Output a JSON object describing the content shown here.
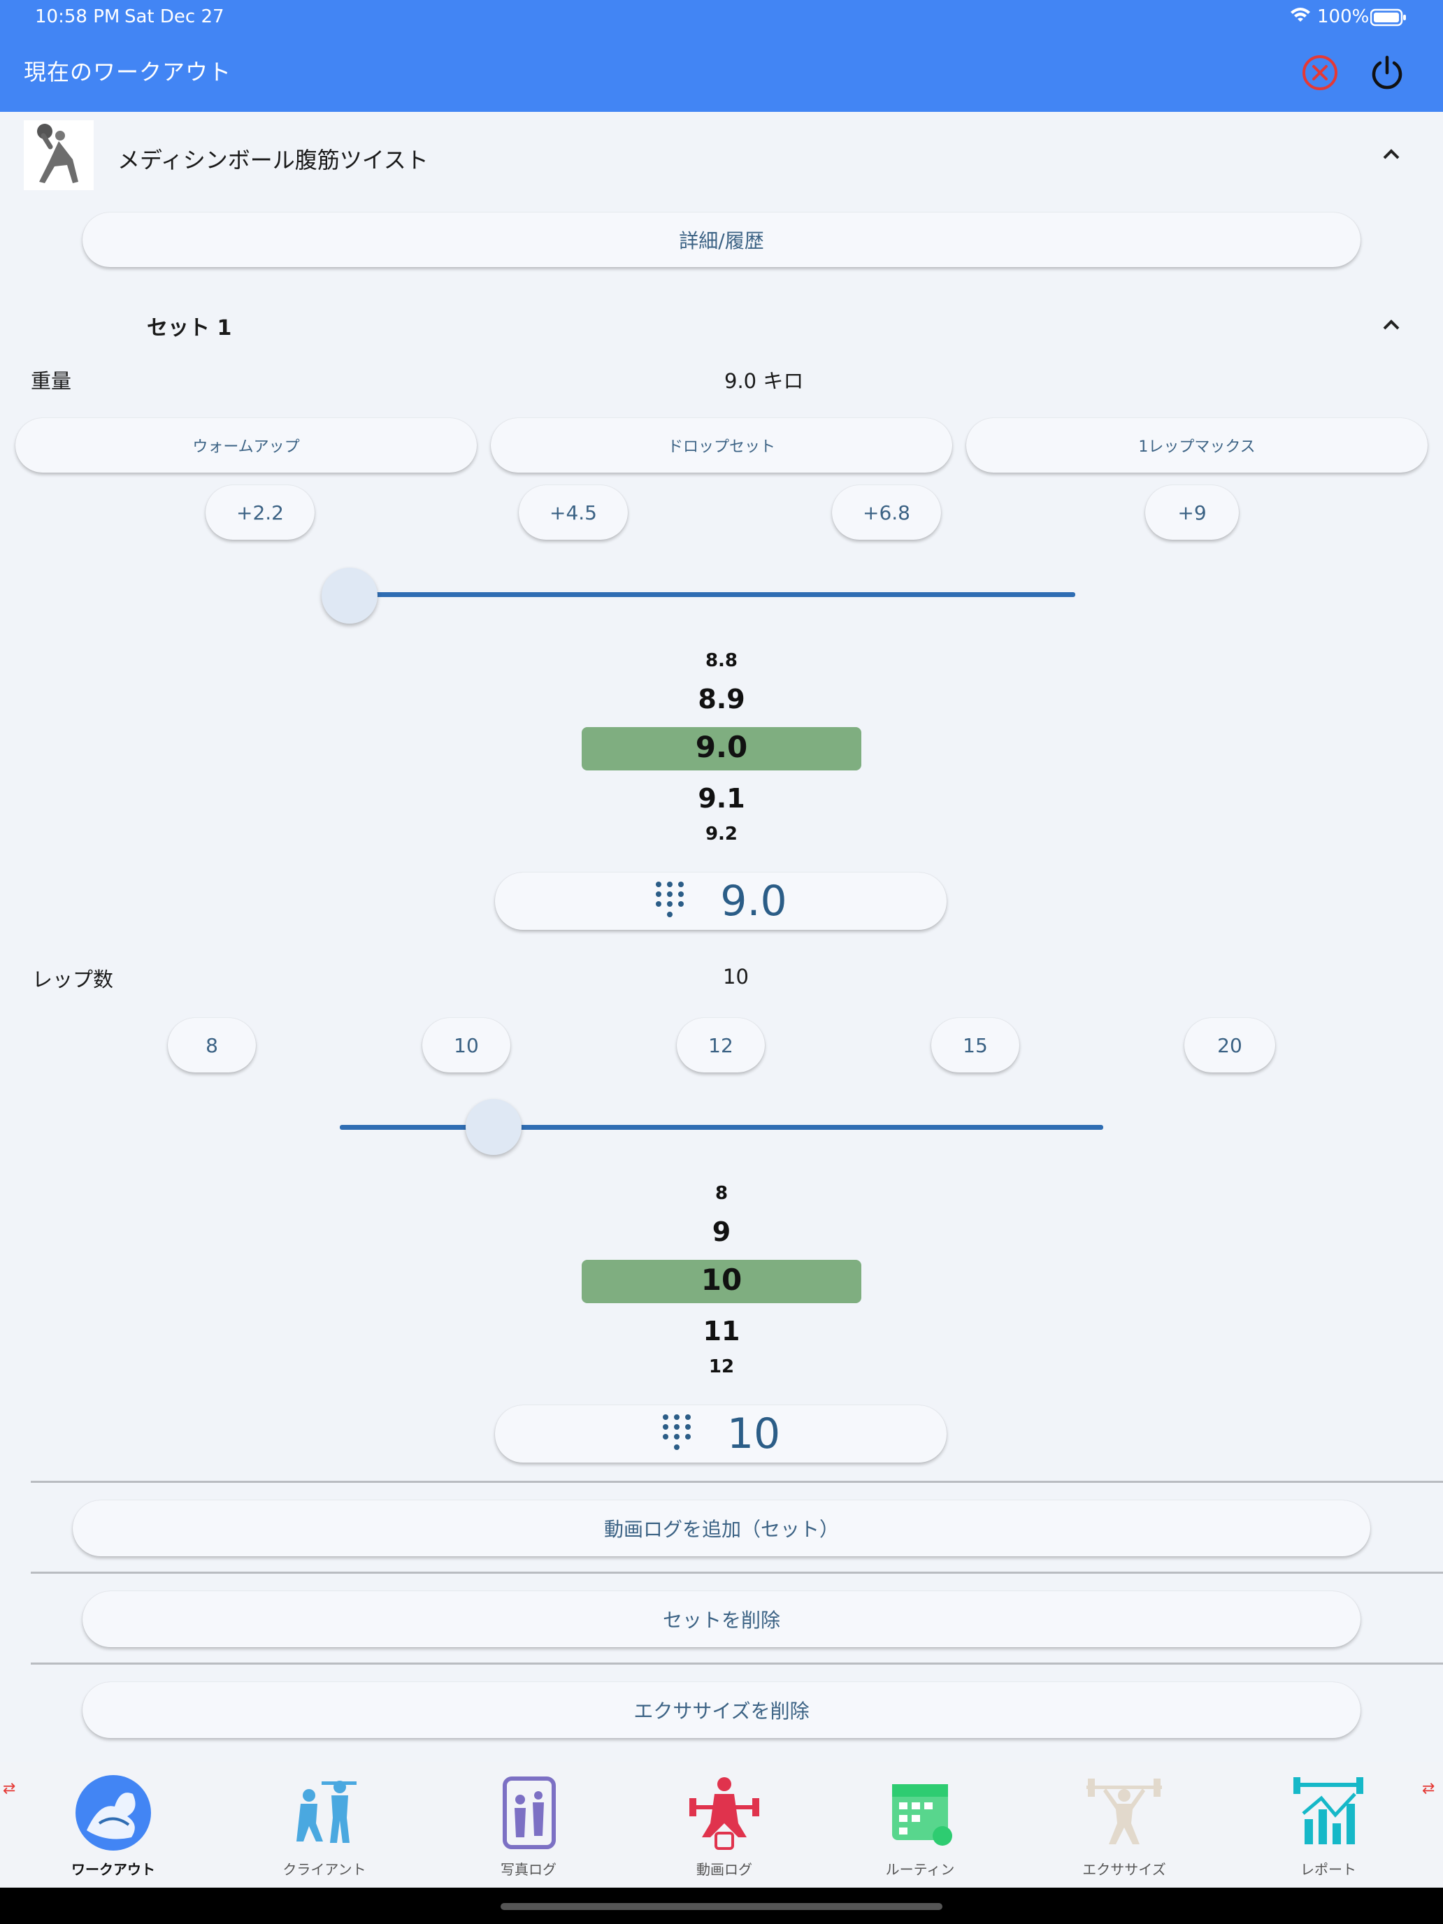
{
  "status": {
    "time": "10:58 PM",
    "date": "Sat Dec 27",
    "battery": "100%"
  },
  "appbar": {
    "title": "現在のワークアウト",
    "close_icon": "close-circle-icon",
    "power_icon": "power-icon"
  },
  "exercise": {
    "name": "メディシンボール腹筋ツイスト",
    "details_label": "詳細/履歴"
  },
  "set": {
    "title": "セット 1"
  },
  "weight": {
    "label": "重量",
    "value_text": "9.0 キロ",
    "modes": [
      "ウォームアップ",
      "ドロップセット",
      "1レップマックス"
    ],
    "increments": [
      "+2.2",
      "+4.5",
      "+6.8",
      "+9"
    ],
    "slider_fraction": 0.0,
    "wheel": [
      "8.8",
      "8.9",
      "9.0",
      "9.1",
      "9.2"
    ],
    "entry_value": "9.0"
  },
  "reps": {
    "label": "レップ数",
    "value_text": "10",
    "presets": [
      "8",
      "10",
      "12",
      "15",
      "20"
    ],
    "slider_fraction": 0.2,
    "wheel": [
      "8",
      "9",
      "10",
      "11",
      "12"
    ],
    "entry_value": "10"
  },
  "actions": {
    "add_video": "動画ログを追加（セット）",
    "delete_set": "セットを削除",
    "delete_exercise": "エクササイズを削除"
  },
  "nav": [
    {
      "label": "ワークアウト",
      "icon": "muscle-arm-icon",
      "active": true
    },
    {
      "label": "クライアント",
      "icon": "trainer-client-icon",
      "active": false
    },
    {
      "label": "写真ログ",
      "icon": "photo-log-icon",
      "active": false
    },
    {
      "label": "動画ログ",
      "icon": "video-log-icon",
      "active": false
    },
    {
      "label": "ルーティン",
      "icon": "calendar-routine-icon",
      "active": false
    },
    {
      "label": "エクササイズ",
      "icon": "weightlifter-icon",
      "active": false
    },
    {
      "label": "レポート",
      "icon": "chart-report-icon",
      "active": false
    }
  ],
  "colors": {
    "appbar": "#4285f4",
    "accent": "#2f6db3",
    "highlight": "#7fae80",
    "close": "#e53935"
  }
}
